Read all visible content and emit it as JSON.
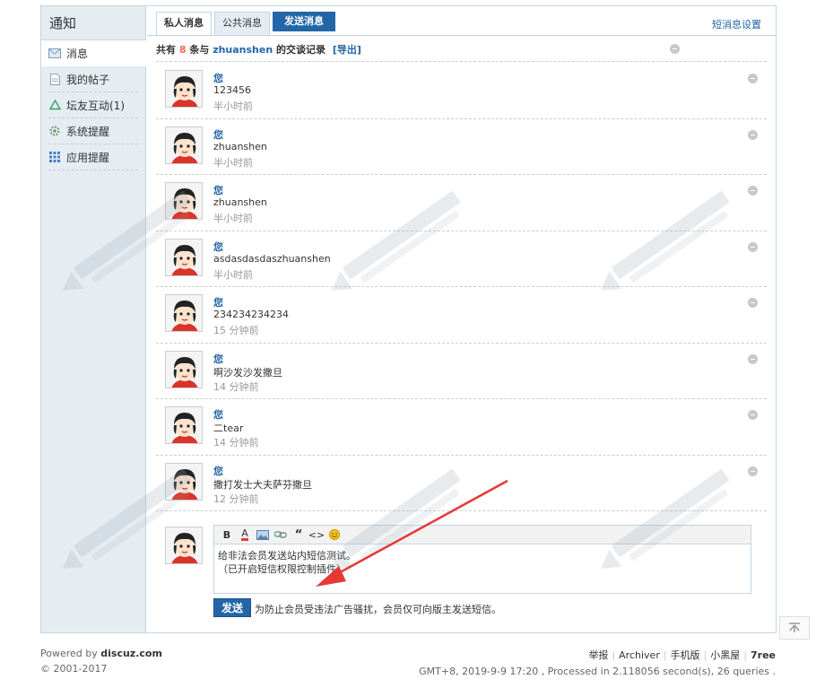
{
  "sidebar": {
    "title": "通知",
    "items": [
      {
        "label": "消息",
        "icon": "envelope-icon"
      },
      {
        "label": "我的帖子",
        "icon": "document-icon"
      },
      {
        "label": "坛友互动(1)",
        "icon": "recycle-icon"
      },
      {
        "label": "系统提醒",
        "icon": "gear-icon"
      },
      {
        "label": "应用提醒",
        "icon": "grid-icon"
      }
    ]
  },
  "tabs": {
    "private": "私人消息",
    "public": "公共消息",
    "send": "发送消息",
    "settings": "短消息设置"
  },
  "summary": {
    "prefix": "共有",
    "count": "8",
    "middle": "条与",
    "user": "zhuanshen",
    "suffix": "的交谈记录",
    "export": "[导出]"
  },
  "messages": [
    {
      "who": "您",
      "text": "123456",
      "time": "半小时前"
    },
    {
      "who": "您",
      "text": "zhuanshen",
      "time": "半小时前"
    },
    {
      "who": "您",
      "text": "zhuanshen",
      "time": "半小时前"
    },
    {
      "who": "您",
      "text": "asdasdasdaszhuanshen",
      "time": "半小时前"
    },
    {
      "who": "您",
      "text": "234234234234",
      "time": "15 分钟前"
    },
    {
      "who": "您",
      "text": "啊沙发沙发撒旦",
      "time": "14 分钟前"
    },
    {
      "who": "您",
      "text": "二tear",
      "time": "14 分钟前"
    },
    {
      "who": "您",
      "text": "撒打发士大夫萨芬撒旦",
      "time": "12 分钟前"
    }
  ],
  "editor": {
    "toolbar": [
      "B",
      "A",
      "img",
      "link",
      "“",
      "<>",
      "smile"
    ],
    "line1": "给非法会员发送站内短信测试。",
    "line2": "（已开启短信权限控制插件）"
  },
  "reply": {
    "send_label": "发送",
    "note": "为防止会员受违法广告骚扰，会员仅可向版主发送短信。"
  },
  "footer": {
    "powered_prefix": "Powered by",
    "powered_brand": "discuz.com",
    "copyright": "© 2001-2017",
    "links": [
      "举报",
      "Archiver",
      "手机版",
      "小黑屋"
    ],
    "brand": "7ree",
    "stats": "GMT+8, 2019-9-9 17:20 , Processed in 2.118056 second(s), 26 queries ."
  },
  "colors": {
    "accent": "#2366a8",
    "sidebar_bg": "#e5edf2",
    "border": "#c2d5e3",
    "count_highlight": "#f26c4f",
    "annotation_arrow": "#e53935"
  }
}
